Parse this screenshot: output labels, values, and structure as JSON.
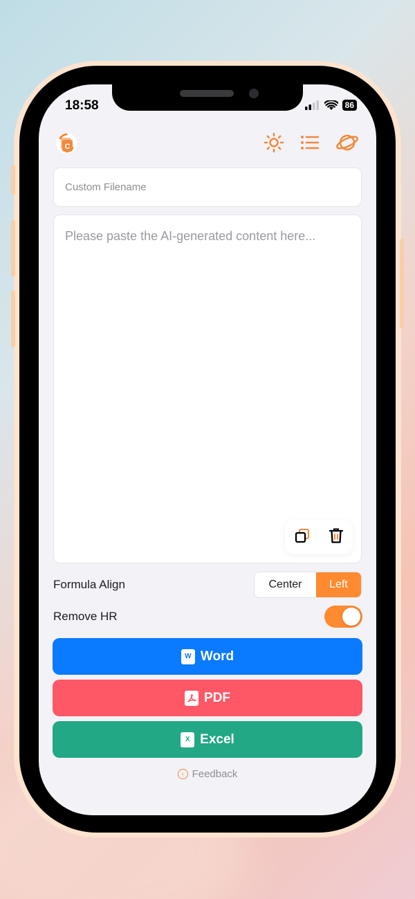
{
  "status_bar": {
    "time": "18:58",
    "battery": "86"
  },
  "header": {
    "logo_icon": "app-logo-icon",
    "theme_icon": "sun-icon",
    "list_icon": "list-icon",
    "language_icon": "planet-icon"
  },
  "filename_field": {
    "placeholder": "Custom Filename",
    "value": ""
  },
  "content_field": {
    "placeholder": "Please paste the AI-generated content here...",
    "value": ""
  },
  "formula_align": {
    "label": "Formula Align",
    "options": [
      "Center",
      "Left"
    ],
    "selected": "Left"
  },
  "remove_hr": {
    "label": "Remove HR",
    "enabled": true
  },
  "actions": {
    "word": {
      "label": "Word",
      "icon_letter": "W",
      "color": "#0a7aff"
    },
    "pdf": {
      "label": "PDF",
      "color": "#fe5766"
    },
    "excel": {
      "label": "Excel",
      "icon_letter": "X",
      "color": "#22a884"
    }
  },
  "feedback": {
    "label": "Feedback"
  },
  "colors": {
    "accent": "#ff8a30",
    "background": "#f2f2f7"
  }
}
